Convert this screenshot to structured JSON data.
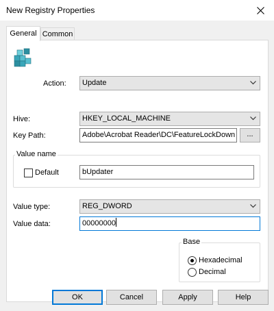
{
  "window": {
    "title": "New Registry Properties"
  },
  "tabs": [
    {
      "label": "General",
      "selected": true
    },
    {
      "label": "Common",
      "selected": false
    }
  ],
  "general": {
    "action": {
      "label": "Action:",
      "value": "Update"
    },
    "hive": {
      "label": "Hive:",
      "value": "HKEY_LOCAL_MACHINE"
    },
    "key_path": {
      "label": "Key Path:",
      "value": "Adobe\\Acrobat Reader\\DC\\FeatureLockDown",
      "browse_label": "..."
    },
    "value_name": {
      "group_label": "Value name",
      "default_label": "Default",
      "default_checked": false,
      "value": "bUpdater"
    },
    "value_type": {
      "label": "Value type:",
      "value": "REG_DWORD"
    },
    "value_data": {
      "label": "Value data:",
      "value": "00000000"
    },
    "base": {
      "group_label": "Base",
      "options": [
        {
          "label": "Hexadecimal",
          "selected": true
        },
        {
          "label": "Decimal",
          "selected": false
        }
      ]
    }
  },
  "buttons": {
    "ok": "OK",
    "cancel": "Cancel",
    "apply": "Apply",
    "help": "Help"
  },
  "colors": {
    "focus_border": "#0078d7",
    "icon_teal": "#3aa6b9",
    "dialog_bg": "#f0f0f0"
  },
  "icons": {
    "action": "registry-cubes-icon",
    "close": "close-icon",
    "dropdown": "chevron-down-icon"
  }
}
